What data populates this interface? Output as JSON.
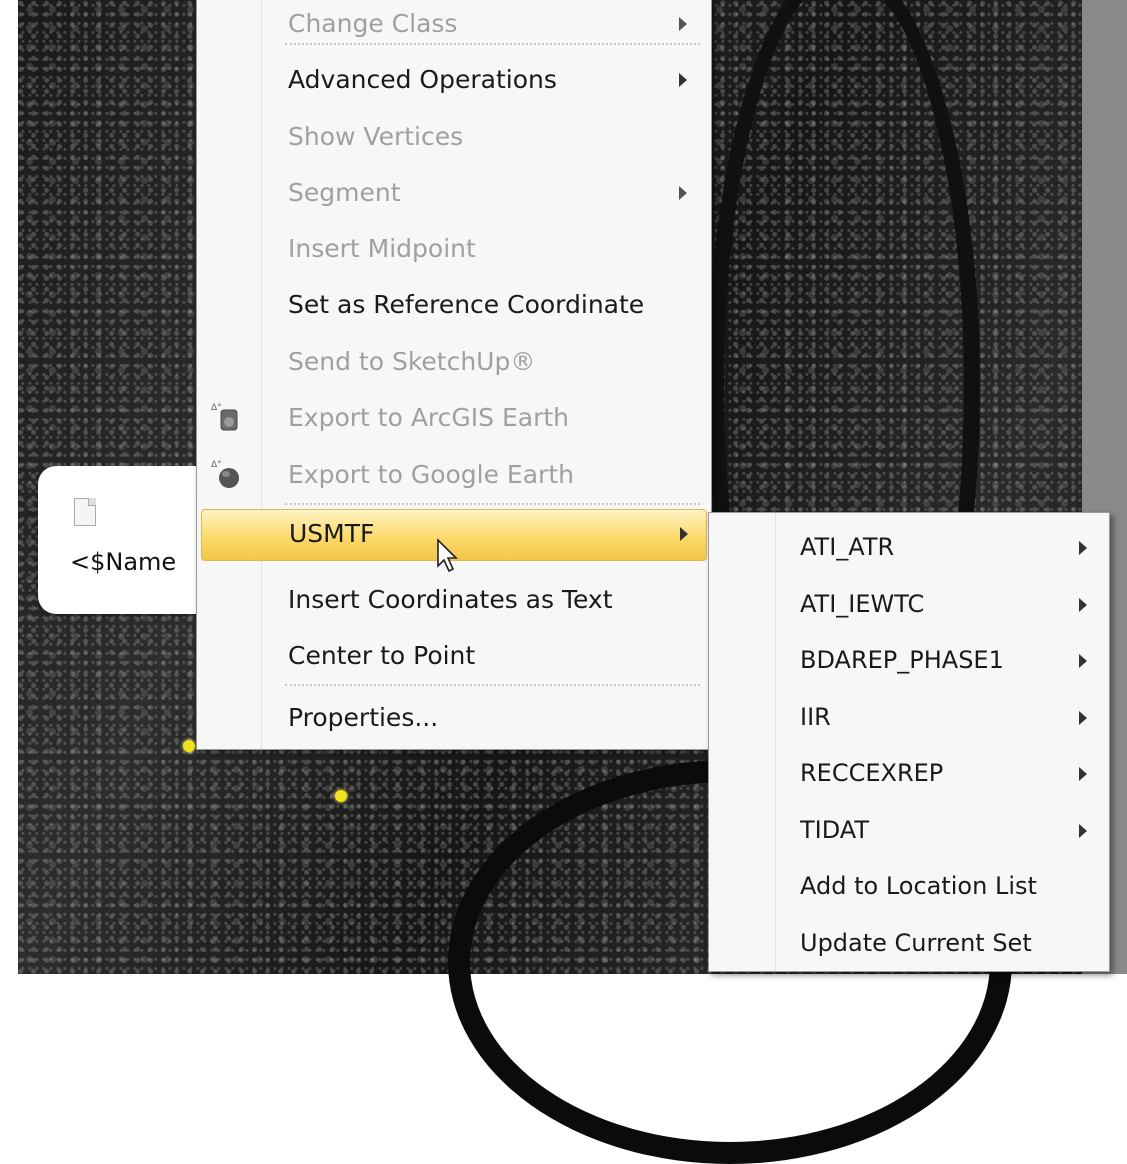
{
  "callout": {
    "name_text": "<$Name"
  },
  "main_menu": {
    "items": [
      {
        "label": "Change Class",
        "enabled": false,
        "submenu": true
      },
      {
        "label": "Advanced Operations",
        "enabled": true,
        "submenu": true
      },
      {
        "label": "Show Vertices",
        "enabled": false,
        "submenu": false
      },
      {
        "label": "Segment",
        "enabled": false,
        "submenu": true
      },
      {
        "label": "Insert Midpoint",
        "enabled": false,
        "submenu": false
      },
      {
        "label": "Set as Reference Coordinate",
        "enabled": true,
        "submenu": false
      },
      {
        "label": "Send to SketchUp®",
        "enabled": false,
        "submenu": false
      },
      {
        "label": "Export to ArcGIS Earth",
        "enabled": false,
        "submenu": false,
        "icon": "arcgis-earth-icon"
      },
      {
        "label": "Export to Google Earth",
        "enabled": false,
        "submenu": false,
        "icon": "google-earth-icon"
      },
      {
        "label": "USMTF",
        "enabled": true,
        "submenu": true,
        "highlighted": true
      },
      {
        "label": "Insert Coordinates as Text",
        "enabled": true,
        "submenu": false
      },
      {
        "label": "Center to Point",
        "enabled": true,
        "submenu": false
      },
      {
        "label": "Properties...",
        "enabled": true,
        "submenu": false
      }
    ]
  },
  "usmtf_submenu": {
    "items": [
      {
        "label": "ATI_ATR",
        "submenu": true
      },
      {
        "label": "ATI_IEWTC",
        "submenu": true
      },
      {
        "label": "BDAREP_PHASE1",
        "submenu": true
      },
      {
        "label": "IIR",
        "submenu": true
      },
      {
        "label": "RECCEXREP",
        "submenu": true
      },
      {
        "label": "TIDAT",
        "submenu": true
      },
      {
        "label": "Add to Location List",
        "submenu": false
      },
      {
        "label": "Update Current Set",
        "submenu": false
      }
    ]
  },
  "colors": {
    "highlight": "#fbd96a",
    "disabled_text": "#a0a0a0",
    "marker": "#f1e21b"
  }
}
